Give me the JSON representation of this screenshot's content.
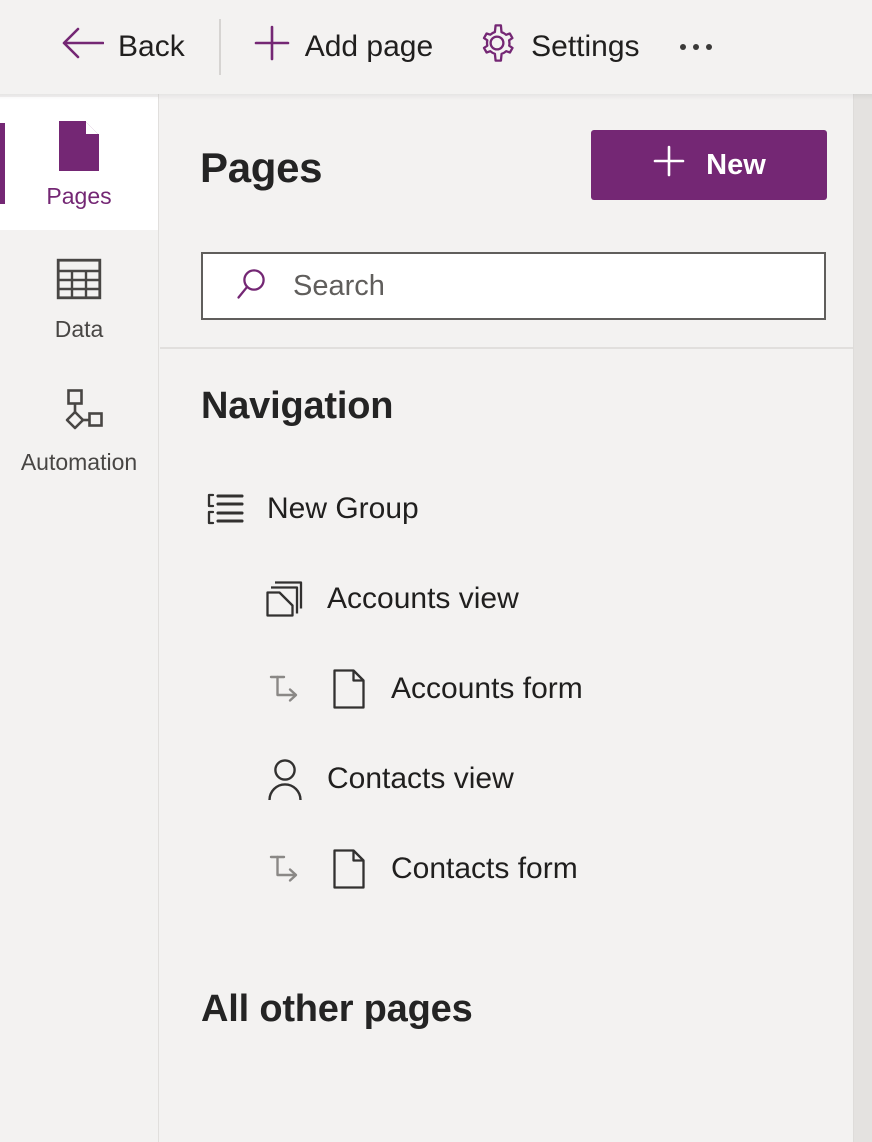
{
  "toolbar": {
    "back_label": "Back",
    "add_page_label": "Add page",
    "settings_label": "Settings",
    "overflow_label": "More commands",
    "back_icon": "arrow-left-icon",
    "add_icon": "plus-icon",
    "settings_icon": "gear-icon",
    "overflow_icon": "ellipsis-icon"
  },
  "rail": {
    "items": [
      {
        "label": "Pages",
        "icon": "page-icon",
        "selected": true
      },
      {
        "label": "Data",
        "icon": "table-icon",
        "selected": false
      },
      {
        "label": "Automation",
        "icon": "flow-icon",
        "selected": false
      }
    ]
  },
  "main": {
    "title": "Pages",
    "new_button_label": "New",
    "new_button_icon": "plus-icon",
    "search": {
      "placeholder": "Search",
      "value": "",
      "icon": "search-icon"
    },
    "navigation": {
      "heading": "Navigation",
      "items": [
        {
          "label": "New Group",
          "icon": "group-list-icon",
          "level": 0,
          "has_sub_arrow": false
        },
        {
          "label": "Accounts view",
          "icon": "views-stack-icon",
          "level": 1,
          "has_sub_arrow": false
        },
        {
          "label": "Accounts form",
          "icon": "document-icon",
          "level": 2,
          "has_sub_arrow": true
        },
        {
          "label": "Contacts view",
          "icon": "contact-person-icon",
          "level": 1,
          "has_sub_arrow": false
        },
        {
          "label": "Contacts form",
          "icon": "document-icon",
          "level": 2,
          "has_sub_arrow": true
        }
      ]
    },
    "other_pages": {
      "heading": "All other pages"
    }
  },
  "colors": {
    "accent": "#742774",
    "app_background": "#f3f2f1",
    "text_primary": "#201f1e",
    "border": "#e1dfdd"
  }
}
